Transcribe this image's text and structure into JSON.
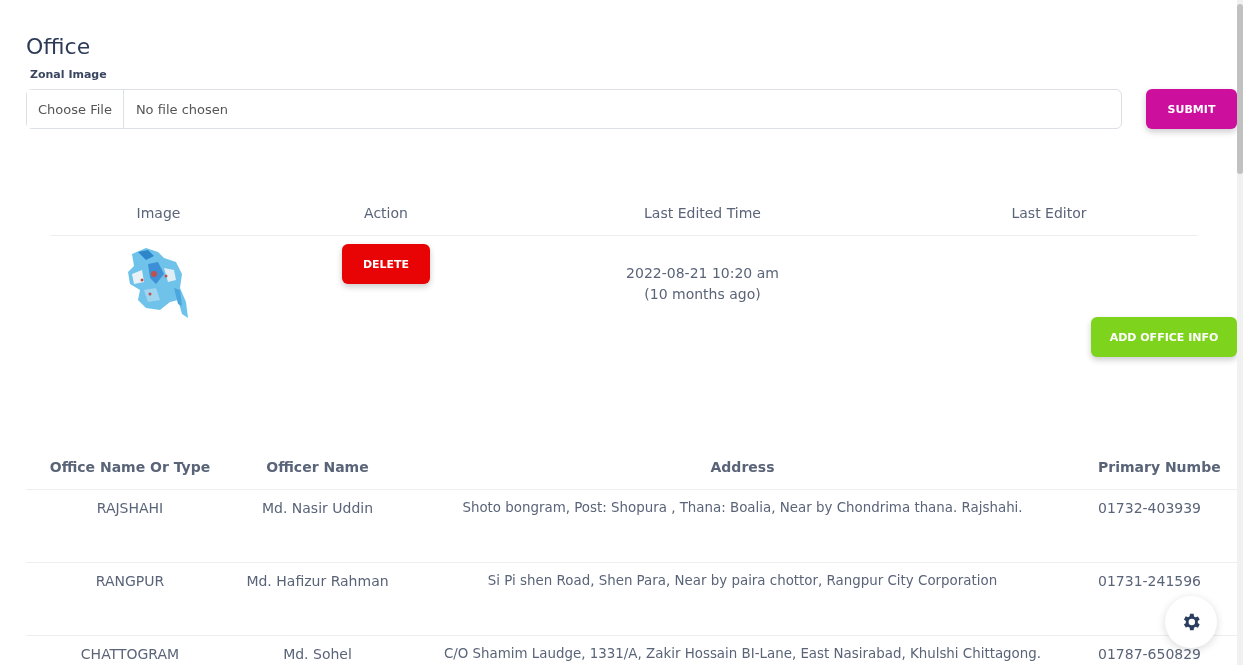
{
  "page_title": "Office",
  "upload": {
    "label": "Zonal Image",
    "choose_button": "Choose File",
    "file_status": "No file chosen",
    "submit_button": "SUBMIT"
  },
  "image_table": {
    "columns": [
      "Image",
      "Action",
      "Last Edited Time",
      "Last Editor"
    ],
    "rows": [
      {
        "action": "DELETE",
        "edited_date": "2022-08-21 10:20 am",
        "edited_ago": "(10 months ago)"
      }
    ]
  },
  "add_button": "ADD OFFICE INFO",
  "office_table": {
    "columns": [
      "Office Name Or Type",
      "Officer Name",
      "Address",
      "Primary Numbe"
    ],
    "rows": [
      [
        "RAJSHAHI",
        "Md. Nasir Uddin",
        "Shoto bongram, Post: Shopura , Thana: Boalia, Near by Chondrima thana. Rajshahi.",
        "01732-403939"
      ],
      [
        "RANGPUR",
        "Md. Hafizur Rahman",
        "Si Pi shen Road, Shen Para, Near by paira chottor, Rangpur City Corporation",
        "01731-241596"
      ],
      [
        "CHATTOGRAM",
        "Md. Sohel",
        "C/O Shamim Laudge, 1331/A, Zakir Hossain BI-Lane, East Nasirabad, Khulshi Chittagong.",
        "01787-650829"
      ]
    ]
  }
}
